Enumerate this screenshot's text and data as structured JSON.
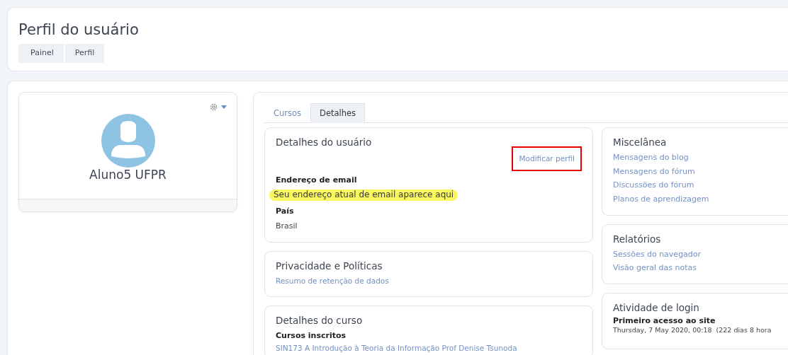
{
  "header": {
    "title": "Perfil do usuário",
    "breadcrumb": [
      {
        "label": "Painel"
      },
      {
        "label": "Perfil"
      }
    ]
  },
  "profile": {
    "name": "Aluno5 UFPR"
  },
  "tabs": [
    {
      "label": "Cursos",
      "selected": false
    },
    {
      "label": "Detalhes",
      "selected": true
    }
  ],
  "user_details": {
    "title": "Detalhes do usuário",
    "edit_link": {
      "label": "Modificar perfil",
      "outlined": true
    },
    "fields": [
      {
        "label": "Endereço de email",
        "value": "Seu endereço atual de email aparece aqui",
        "highlighted": true
      },
      {
        "label": "País",
        "value": "Brasil",
        "highlighted": false
      }
    ]
  },
  "privacy": {
    "title": "Privacidade e Políticas",
    "links": [
      "Resumo de retenção de dados"
    ]
  },
  "course_details": {
    "title": "Detalhes do curso",
    "subtitle": "Cursos inscritos",
    "links": [
      "SIN173 A Introdução à Teoria da Informação Prof Denise Tsunoda"
    ]
  },
  "misc": {
    "title": "Miscelânea",
    "links": [
      "Mensagens do blog",
      "Mensagens do fórum",
      "Discussões do fórum",
      "Planos de aprendizagem"
    ]
  },
  "reports": {
    "title": "Relatórios",
    "links": [
      "Sessões do navegador",
      "Visão geral das notas"
    ]
  },
  "login": {
    "title": "Atividade de login",
    "label": "Primeiro acesso ao site",
    "value": "Thursday, 7 May 2020, 00:18  (222 dias 8 hora"
  }
}
